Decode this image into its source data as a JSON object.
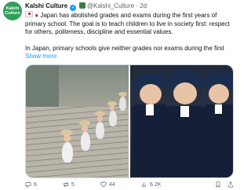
{
  "author": {
    "avatar_line1": "Kalshi",
    "avatar_line2": "Culture",
    "name": "Kalshi Culture",
    "handle": "@Kalshi_Culture",
    "separator": "·",
    "time": "2d"
  },
  "tweet": {
    "line1_text": "Japan has abolished grades and exams during the first years of primary school. The goal is to teach children to live in society first: respect for others, politeness, discipline and essential values.",
    "line2_text": "In Japan, primary schools give neither grades nor exams during the first",
    "show_more": "Show more"
  },
  "media": {
    "images": [
      "students-on-stairs",
      "students-in-uniforms"
    ]
  },
  "actions": {
    "replies": "6",
    "retweets": "5",
    "likes": "44",
    "views": "6.2K"
  },
  "colors": {
    "link": "#1d9bf0",
    "muted": "#536471",
    "avatar_bg": "#2f9e5b"
  }
}
